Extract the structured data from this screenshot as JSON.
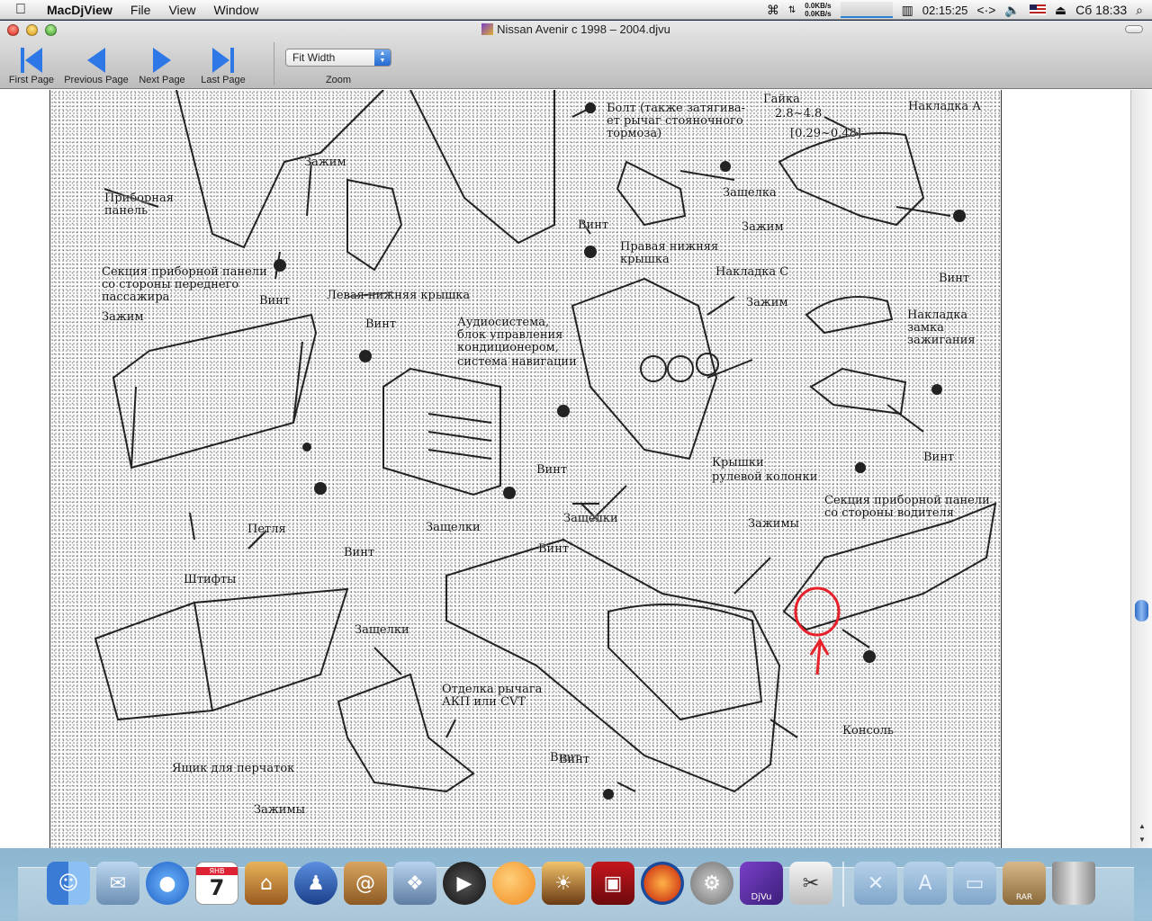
{
  "menubar": {
    "app_name": "MacDjView",
    "menus": [
      "File",
      "View",
      "Window"
    ],
    "net_up": "0.0KB/s",
    "net_down": "0.0KB/s",
    "uptime": "02:15:25",
    "clock": "Сб 18:33"
  },
  "window": {
    "title": "Nissan Avenir с 1998 – 2004.djvu"
  },
  "toolbar": {
    "first_page": "First Page",
    "previous_page": "Previous Page",
    "next_page": "Next Page",
    "last_page": "Last Page",
    "zoom_value": "Fit Width",
    "zoom_label": "Zoom"
  },
  "accent_color": "#2e6bc6",
  "annotation_color": "#e8202a",
  "diagram": {
    "callouts": [
      "Гайка",
      "2.8~4.8",
      "[0.29~0.48]",
      "Болт (также затягива-",
      "ет рычаг стояночного",
      "тормоза)",
      "Накладка А",
      "Зажим",
      "Приборная",
      "панель",
      "Защелка",
      "Винт",
      "Зажим",
      "Правая нижняя",
      "крышка",
      "Винт",
      "Секция приборной панели",
      "со стороны переднего",
      "пассажира",
      "Винт",
      "Левая нижняя крышка",
      "Накладка С",
      "Зажим",
      "Зажим",
      "Винт",
      "Аудиосистема,",
      "блок управления",
      "кондиционером,",
      "система навигации",
      "Накладка",
      "замка",
      "зажигания",
      "Винт",
      "Винт",
      "Крышки",
      "рулевой колонки",
      "Секция приборной панели",
      "со стороны водителя",
      "Петля",
      "Винт",
      "Защелки",
      "Винт",
      "Защелки",
      "Зажимы",
      "Штифты",
      "Защелки",
      "Винт",
      "Отделка рычага",
      "АКП или CVT",
      "Консоль",
      "Ящик для перчаток",
      "Винт",
      "Зажимы"
    ]
  },
  "dock": {
    "items": [
      "finder-icon",
      "mail-icon",
      "ichat-icon",
      "ical-icon",
      "bucket-icon",
      "gnome-icon",
      "address-book-icon",
      "photo-icon",
      "dvd-player-icon",
      "orange-icon",
      "iphoto-icon",
      "photo-booth-icon",
      "firefox-icon",
      "system-preferences-icon",
      "djview-icon",
      "preview-icon"
    ],
    "calendar_day": "7",
    "calendar_month": "ЯНВ",
    "rar_label": "RAR",
    "djvu_label": "DjVu"
  }
}
